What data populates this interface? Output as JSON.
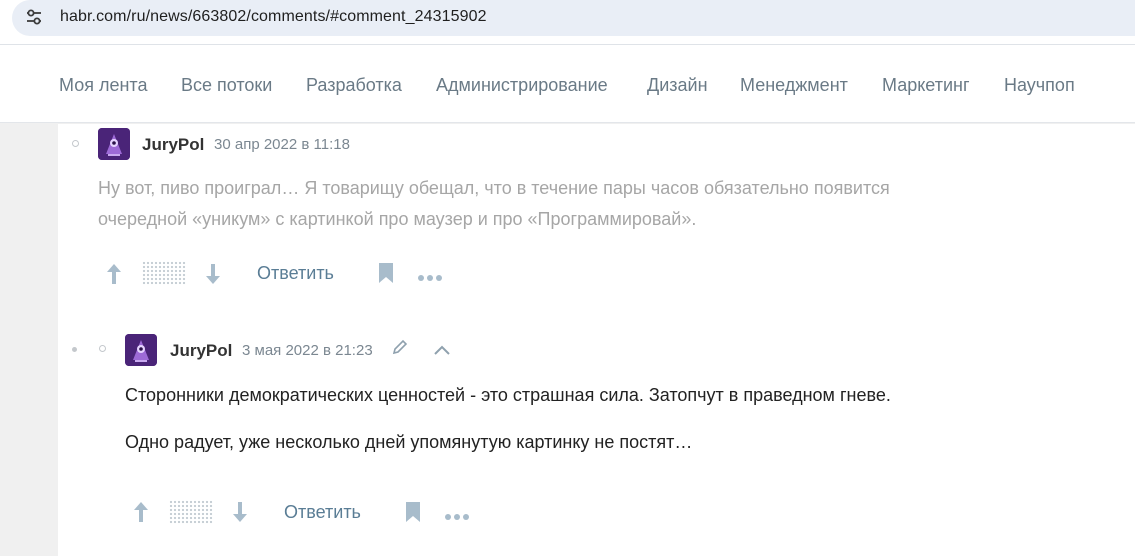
{
  "browser": {
    "url": "habr.com/ru/news/663802/comments/#comment_24315902",
    "site_icon": "tune-icon"
  },
  "nav": {
    "items": [
      "Моя лента",
      "Все потоки",
      "Разработка",
      "Администрирование",
      "Дизайн",
      "Менеджмент",
      "Маркетинг",
      "Научпоп"
    ]
  },
  "comments": [
    {
      "author": "JuryPol",
      "date": "30 апр 2022 в 11:18",
      "paragraphs": [
        "Ну вот, пиво проиграл… Я товарищу обещал, что в течение пары часов обязательно появится",
        "очередной «уникум» с картинкой про маузер и про «Программировай»."
      ],
      "faded": true,
      "reply_label": "Ответить"
    },
    {
      "author": "JuryPol",
      "date": "3 мая 2022 в 21:23",
      "paragraphs": [
        "Сторонники демократических ценностей - это страшная сила. Затопчут в праведном гневе.",
        "Одно радует, уже несколько дней упомянутую картинку не постят…"
      ],
      "faded": false,
      "reply_label": "Ответить"
    }
  ],
  "colors": {
    "accent": "#5a7d95",
    "avatar_bg": "#5b2e8c"
  }
}
